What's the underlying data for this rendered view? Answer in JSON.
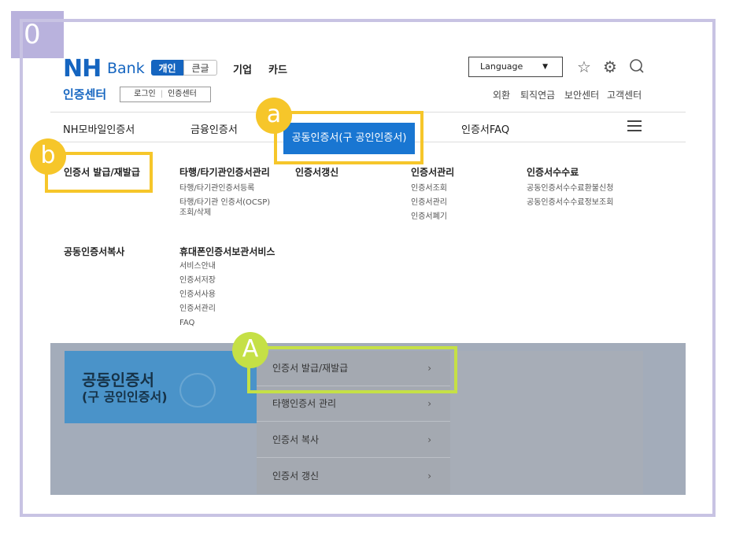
{
  "step": "0",
  "header": {
    "logo_nh": "NH",
    "logo_bank": "Bank",
    "segment": [
      "개인",
      "큰글"
    ],
    "top_links": [
      "기업",
      "카드"
    ],
    "cert_center": "인증센터",
    "util": [
      "로그인",
      "인증센터"
    ],
    "language": "Language",
    "right_links": [
      "외환",
      "퇴직연금",
      "보안센터",
      "고객센터"
    ]
  },
  "nav": {
    "items": [
      "NH모바일인증서",
      "금융인증서",
      "공동인증서(구 공인인증서)",
      "인증서FAQ"
    ]
  },
  "markers": {
    "a": "a",
    "b": "b",
    "A": "A"
  },
  "menu": {
    "col1": {
      "title": "인증서 발급/재발급"
    },
    "col2": {
      "title": "타행/타기관인증서관리",
      "items": [
        "타행/타기관인증서등록",
        "타행/타기관 인증서(OCSP)",
        "조회/삭제"
      ]
    },
    "col3": {
      "title": "인증서갱신"
    },
    "col4": {
      "title": "인증서관리",
      "items": [
        "인증서조회",
        "인증서관리",
        "인증서폐기"
      ]
    },
    "col5": {
      "title": "인증서수수료",
      "items": [
        "공동인증서수수료환불신청",
        "공동인증서수수료정보조회"
      ]
    },
    "col6": {
      "title": "공동인증서복사"
    },
    "col7": {
      "title": "휴대폰인증서보관서비스",
      "items": [
        "서비스안내",
        "인증서저장",
        "인증서사용",
        "인증서관리",
        "FAQ"
      ]
    }
  },
  "hero": {
    "line1": "공동인증서",
    "line2": "(구 공인인증서)"
  },
  "panel": {
    "rows": [
      "인증서 발급/재발급",
      "타행인증서 관리",
      "인증서 복사",
      "인증서 갱신"
    ],
    "chevron": "›"
  }
}
